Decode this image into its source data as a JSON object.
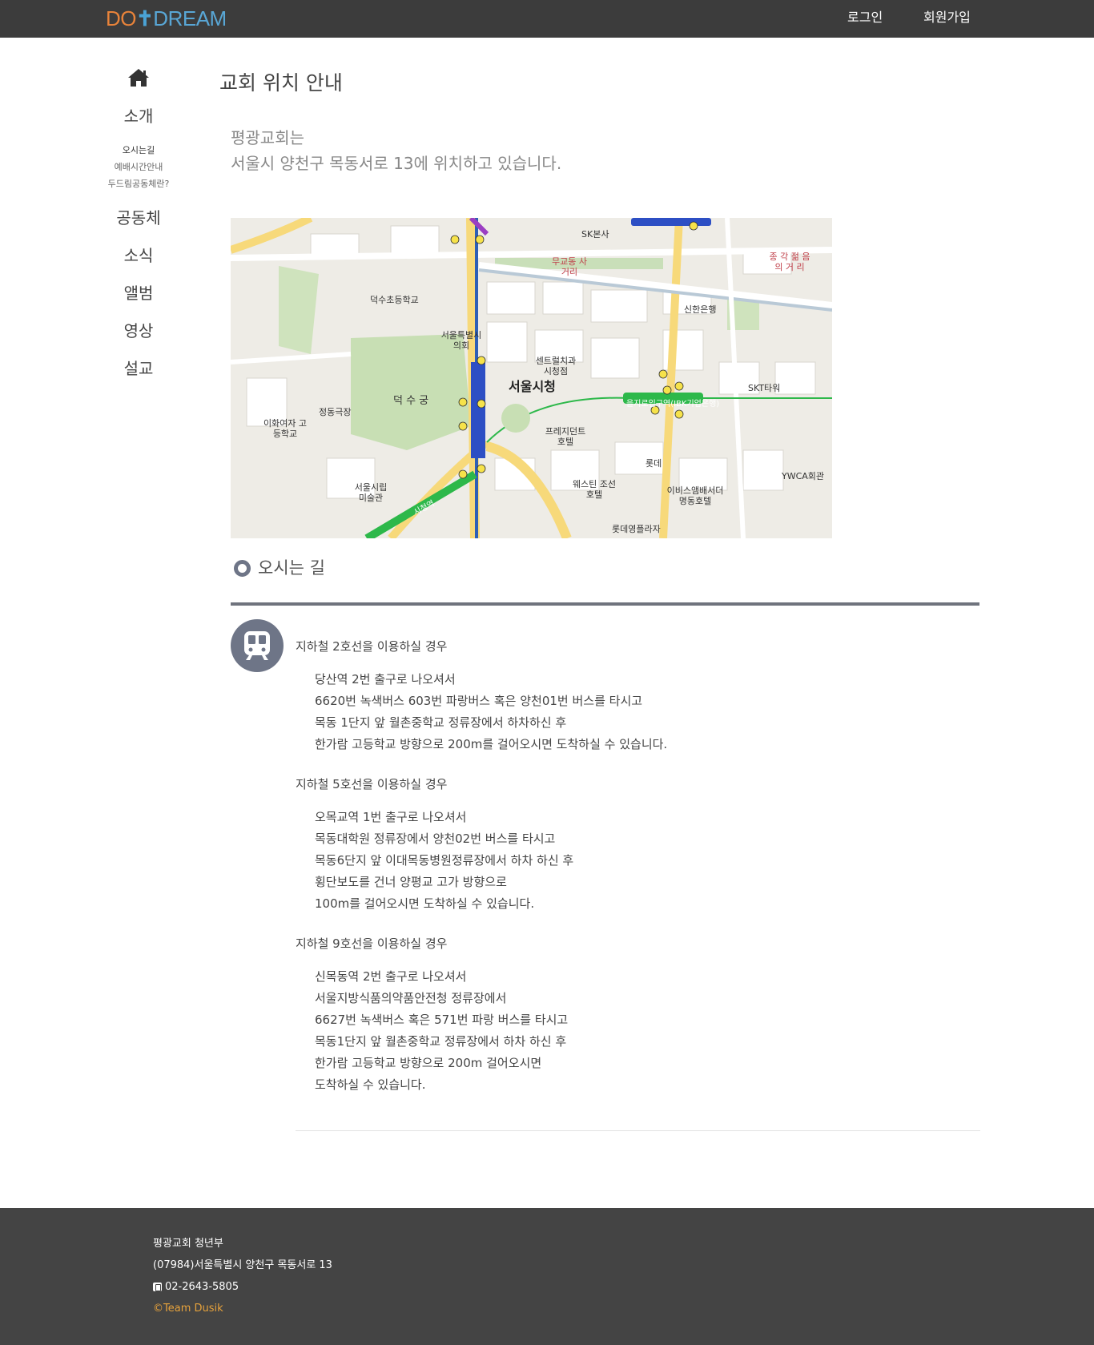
{
  "header": {
    "logo_do": "DO",
    "logo_cross": "✝",
    "logo_dream": "DREAM",
    "login": "로그인",
    "signup": "회원가입"
  },
  "sidebar": {
    "home_icon": "home-icon",
    "sections": [
      {
        "label": "소개"
      },
      {
        "label": "공동체"
      },
      {
        "label": "소식"
      },
      {
        "label": "앨범"
      },
      {
        "label": "영상"
      },
      {
        "label": "설교"
      }
    ],
    "sub_items": [
      {
        "label": "오시는길",
        "active": true
      },
      {
        "label": "예배시간안내",
        "active": false
      },
      {
        "label": "두드림공동체란?",
        "active": false
      }
    ]
  },
  "main": {
    "title": "교회 위치 안내",
    "intro_line1": "평광교회는",
    "intro_line2": "서울시 양천구 목동서로 13에 위치하고 있습니다.",
    "map": {
      "labels": {
        "city_hall": "서울시청",
        "deoksugung": "덕 수 궁",
        "seoul_plaza": "서울특별시 의회",
        "president_hotel": "프레지던트 호텔",
        "lotte": "롯데",
        "ewha": "이화여자 고등학교",
        "skt": "SKT타워",
        "ibk": "을지로입구역(IBK기업은행)",
        "shinhan": "신한은행",
        "seoul_museum": "서울시립 미술관",
        "ywca": "YWCA회관",
        "jonggak": "종 각 젊 음 의 거 리",
        "mugyodong": "무교동 사거리",
        "sk": "SK본사",
        "center": "센트럴치과 시청점",
        "westin": "웨스틴 조선호텔",
        "lotte_plaza": "롯데영플라자",
        "deoksu_school": "덕수초등학교",
        "jeongdong": "정동극장",
        "ibis": "이비스앰배서더 명동호텔",
        "city_station": "시청역"
      }
    },
    "section_title": "오시는 길",
    "directions": [
      {
        "head": "지하철 2호선을 이용하실 경우",
        "lines": [
          "당산역 2번 출구로 나오셔서",
          "6620번 녹색버스 603번 파랑버스 혹은 양천01번 버스를 타시고",
          "목동 1단지 앞 월촌중학교 정류장에서 하차하신 후",
          "한가람 고등학교 방향으로 200m를 걸어오시면 도착하실 수 있습니다."
        ]
      },
      {
        "head": "지하철 5호선을 이용하실 경우",
        "lines": [
          "오목교역 1번 출구로 나오셔서",
          "목동대학원 정류장에서 양천02번 버스를 타시고",
          "목동6단지 앞 이대목동병원정류장에서 하차 하신 후",
          "횡단보도를 건너 양평교 고가 방향으로",
          "100m를 걸어오시면 도착하실 수 있습니다."
        ]
      },
      {
        "head": "지하철 9호선을 이용하실 경우",
        "lines": [
          "신목동역 2번 출구로 나오셔서",
          "서울지방식품의약품안전청 정류장에서",
          "6627번 녹색버스 혹은 571번 파랑 버스를 타시고",
          "목동1단지 앞 월촌중학교 정류장에서 하차 하신 후",
          "한가람 고등학교 방향으로 200m 걸어오시면",
          "도착하실 수 있습니다."
        ]
      }
    ]
  },
  "footer": {
    "org": "평광교회 청년부",
    "address": "(07984)서울특별시 양천구 목동서로 13",
    "phone": "02-2643-5805",
    "copyright": "©Team Dusik"
  },
  "colors": {
    "topbar": "#3c3c3c",
    "accent_gray": "#6e7587",
    "footer": "#444444",
    "copyright": "#e6a23c"
  }
}
